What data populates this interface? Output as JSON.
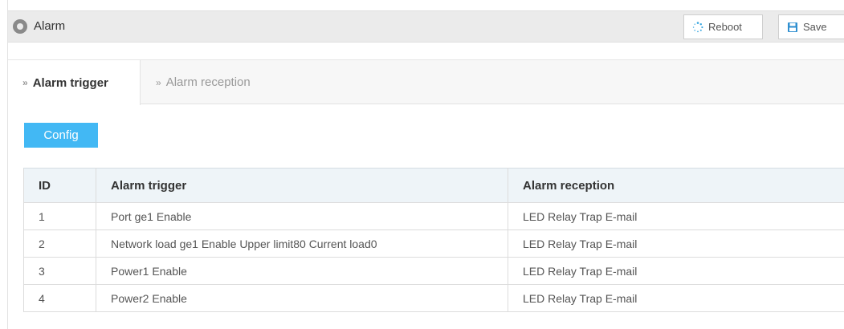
{
  "header": {
    "title": "Alarm",
    "reboot_label": "Reboot",
    "save_label": "Save"
  },
  "tabs": [
    {
      "label": "Alarm trigger",
      "active": true
    },
    {
      "label": "Alarm reception",
      "active": false
    }
  ],
  "config_label": "Config",
  "table": {
    "columns": [
      "ID",
      "Alarm trigger",
      "Alarm reception"
    ],
    "rows": [
      [
        "1",
        "Port ge1 Enable",
        "LED Relay Trap E-mail"
      ],
      [
        "2",
        "Network load ge1 Enable Upper limit80 Current load0",
        "LED Relay Trap E-mail"
      ],
      [
        "3",
        "Power1 Enable",
        "LED Relay Trap E-mail"
      ],
      [
        "4",
        "Power2 Enable",
        "LED Relay Trap E-mail"
      ]
    ]
  },
  "colors": {
    "accent": "#42b8f4",
    "header_bg": "#ebebeb",
    "table_header_bg": "#eef4f8"
  },
  "icons": {
    "title": "location-pin-icon",
    "reboot": "reboot-spinner-icon",
    "save": "save-disk-icon",
    "tab": "double-chevron-right-icon"
  }
}
